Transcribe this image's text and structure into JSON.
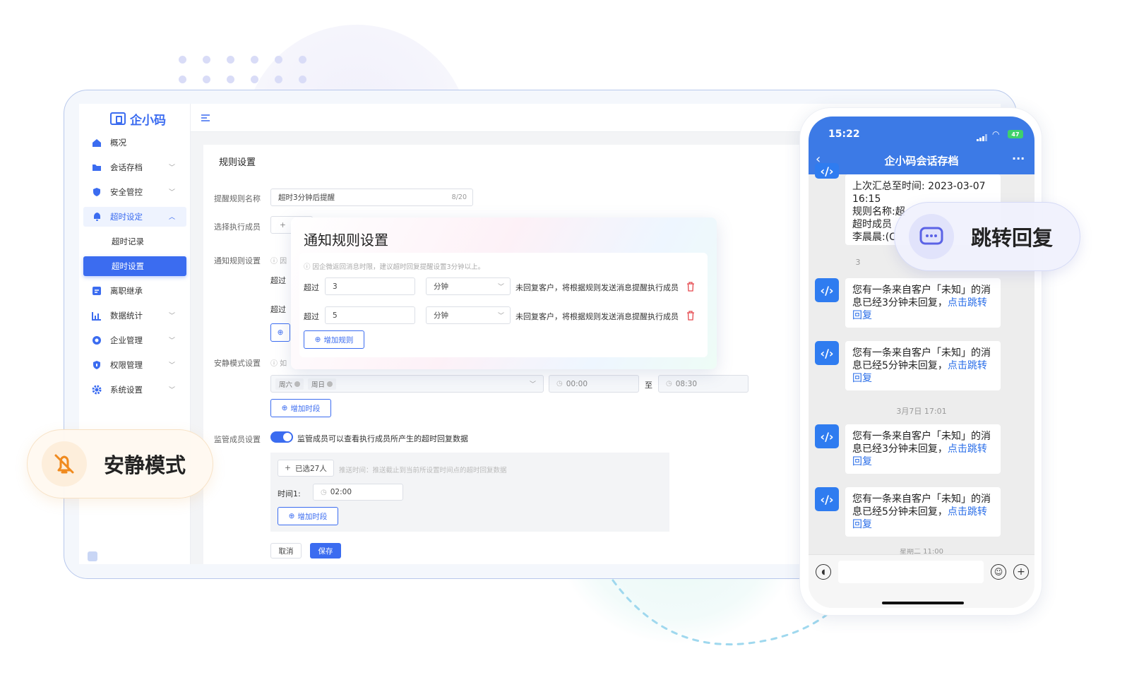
{
  "app": {
    "logo_text": "企小码"
  },
  "sidebar": {
    "items": [
      {
        "label": "概况"
      },
      {
        "label": "会话存档"
      },
      {
        "label": "安全管控"
      },
      {
        "label": "超时设定"
      },
      {
        "label": "超时记录"
      },
      {
        "label": "超时设置"
      },
      {
        "label": "离职继承"
      },
      {
        "label": "数据统计"
      },
      {
        "label": "企业管理"
      },
      {
        "label": "权限管理"
      },
      {
        "label": "系统设置"
      }
    ]
  },
  "form": {
    "section_title": "规则设置",
    "rule_name_label": "提醒规则名称",
    "rule_name_value": "超时3分钟后提醒",
    "rule_name_count": "8/20",
    "executor_label": "选择执行成员",
    "notify_label": "通知规则设置",
    "notify_hint_short": "ⓘ 因",
    "exceed_short": "超过",
    "quiet_label": "安静模式设置",
    "quiet_hint_short": "ⓘ 如",
    "quiet_days": [
      "周六",
      "周日"
    ],
    "time_start": "00:00",
    "to": "至",
    "time_end": "08:30",
    "add_period": "增加时段",
    "supervisor_label": "监管成员设置",
    "supervisor_text": "监管成员可以查看执行成员所产生的超时回复数据",
    "selected_people": "已选27人",
    "push_hint": "推送时间：推送截止到当前所设置时间点的超时回复数据",
    "time1_label": "时间1:",
    "time1_value": "02:00",
    "cancel": "取消",
    "save": "保存"
  },
  "popup": {
    "title": "通知规则设置",
    "hint": "ⓘ 因企微返回消息时限，建议超时回复提醒设置3分钟以上。",
    "rules": [
      {
        "prefix": "超过",
        "value": "3",
        "unit": "分钟",
        "suffix": "未回复客户，将根据规则发送消息提醒执行成员"
      },
      {
        "prefix": "超过",
        "value": "5",
        "unit": "分钟",
        "suffix": "未回复客户，将根据规则发送消息提醒执行成员"
      }
    ],
    "add_rule": "增加规则"
  },
  "phone": {
    "time": "15:22",
    "battery": "47",
    "title": "企小码会话存档",
    "summary_lines": [
      "上次汇总至时间: 2023-03-07",
      "16:15",
      "规则名称:超",
      "超时成员",
      "李晨晨:(C"
    ],
    "messages": [
      {
        "text": "您有一条来自客户「未知」的消息已经3分钟未回复，",
        "link": "点击跳转回复"
      },
      {
        "text": "您有一条来自客户「未知」的消息已经5分钟未回复，",
        "link": "点击跳转回复"
      },
      {
        "text": "您有一条来自客户「未知」的消息已经3分钟未回复，",
        "link": "点击跳转回复"
      },
      {
        "text": "您有一条来自客户「未知」的消息已经5分钟未回复，",
        "link": "点击跳转回复"
      }
    ],
    "ts_partial_top": "3",
    "timestamp": "3月7日 17:01",
    "ts_partial_bottom": "星期二 11:00"
  },
  "callouts": {
    "jump_reply": "跳转回复",
    "quiet_mode": "安静模式"
  },
  "colors": {
    "primary": "#3b6cf0",
    "phone_header": "#3c7ae6",
    "danger": "#e5484d"
  }
}
